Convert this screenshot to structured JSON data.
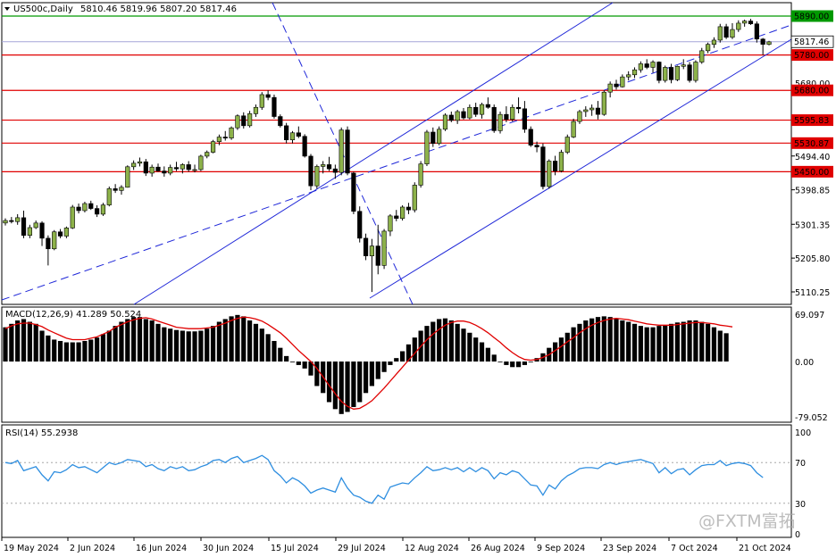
{
  "header": {
    "symbol": "US500c,Daily",
    "ohlc": "5810.46 5819.96 5807.20 5817.46"
  },
  "price_axis": {
    "ticks": [
      "5494.40",
      "5398.85",
      "5301.35",
      "5205.80",
      "5110.25"
    ],
    "current_price": "5817.46",
    "level_labels": [
      "5890.00",
      "5780.00",
      "5680.00",
      "5595.83",
      "5530.87",
      "5450.00"
    ],
    "faint_labels": [
      "5680.00"
    ]
  },
  "macd": {
    "label": "MACD(12,26,9) 41.289 50.524",
    "ticks": [
      "69.097",
      "0.00",
      "-79.052"
    ]
  },
  "rsi": {
    "label": "RSI(14) 55.2938",
    "ticks": [
      "100",
      "70",
      "30",
      "0"
    ]
  },
  "date_axis": {
    "labels": [
      "19 May 2024",
      "2 Jun 2024",
      "16 Jun 2024",
      "30 Jun 2024",
      "15 Jul 2024",
      "29 Jul 2024",
      "12 Aug 2024",
      "26 Aug 2024",
      "9 Sep 2024",
      "23 Sep 2024",
      "7 Oct 2024",
      "21 Oct 2024"
    ]
  },
  "watermark": "@FXTM富拓",
  "colors": {
    "bull": "#8db24a",
    "bear": "#000000",
    "level": "#e00000",
    "green_level": "#009900",
    "channel": "#1f27d8",
    "signal": "#e00000",
    "rsi": "#2e8ee0",
    "current_price_line": "#a6a6d9"
  },
  "chart_data": [
    {
      "type": "candlestick",
      "symbol": "US500c",
      "timeframe": "Daily",
      "y_range": [
        5070,
        5905
      ],
      "horizontal_levels": [
        5890.0,
        5780.0,
        5680.0,
        5595.83,
        5530.87,
        5450.0
      ],
      "current_price": 5817.46,
      "candles": [
        [
          5305,
          5318,
          5298,
          5312
        ],
        [
          5312,
          5322,
          5304,
          5309
        ],
        [
          5309,
          5330,
          5300,
          5320
        ],
        [
          5320,
          5340,
          5262,
          5270
        ],
        [
          5270,
          5300,
          5262,
          5292
        ],
        [
          5292,
          5312,
          5288,
          5305
        ],
        [
          5305,
          5310,
          5240,
          5262
        ],
        [
          5262,
          5270,
          5185,
          5232
        ],
        [
          5232,
          5285,
          5228,
          5280
        ],
        [
          5280,
          5288,
          5262,
          5268
        ],
        [
          5268,
          5295,
          5262,
          5291
        ],
        [
          5291,
          5356,
          5288,
          5350
        ],
        [
          5350,
          5360,
          5332,
          5340
        ],
        [
          5340,
          5365,
          5335,
          5360
        ],
        [
          5360,
          5368,
          5342,
          5346
        ],
        [
          5346,
          5355,
          5322,
          5330
        ],
        [
          5330,
          5362,
          5325,
          5356
        ],
        [
          5356,
          5408,
          5352,
          5402
        ],
        [
          5402,
          5415,
          5390,
          5397
        ],
        [
          5397,
          5412,
          5385,
          5406
        ],
        [
          5406,
          5468,
          5405,
          5464
        ],
        [
          5464,
          5482,
          5455,
          5474
        ],
        [
          5474,
          5490,
          5465,
          5478
        ],
        [
          5478,
          5486,
          5438,
          5446
        ],
        [
          5446,
          5470,
          5436,
          5463
        ],
        [
          5463,
          5473,
          5450,
          5452
        ],
        [
          5452,
          5465,
          5436,
          5446
        ],
        [
          5446,
          5470,
          5440,
          5462
        ],
        [
          5462,
          5478,
          5452,
          5458
        ],
        [
          5458,
          5474,
          5445,
          5470
        ],
        [
          5470,
          5480,
          5450,
          5456
        ],
        [
          5456,
          5470,
          5448,
          5456
        ],
        [
          5456,
          5498,
          5452,
          5494
        ],
        [
          5494,
          5510,
          5488,
          5505
        ],
        [
          5505,
          5540,
          5502,
          5535
        ],
        [
          5535,
          5555,
          5525,
          5548
        ],
        [
          5548,
          5565,
          5538,
          5545
        ],
        [
          5545,
          5578,
          5540,
          5574
        ],
        [
          5574,
          5612,
          5568,
          5608
        ],
        [
          5608,
          5618,
          5572,
          5580
        ],
        [
          5580,
          5622,
          5575,
          5614
        ],
        [
          5614,
          5640,
          5605,
          5632
        ],
        [
          5632,
          5675,
          5625,
          5668
        ],
        [
          5668,
          5680,
          5652,
          5660
        ],
        [
          5660,
          5668,
          5600,
          5606
        ],
        [
          5606,
          5612,
          5575,
          5580
        ],
        [
          5580,
          5588,
          5530,
          5540
        ],
        [
          5540,
          5565,
          5530,
          5560
        ],
        [
          5560,
          5578,
          5545,
          5550
        ],
        [
          5550,
          5556,
          5490,
          5494
        ],
        [
          5494,
          5500,
          5398,
          5410
        ],
        [
          5410,
          5470,
          5402,
          5465
        ],
        [
          5465,
          5480,
          5445,
          5470
        ],
        [
          5470,
          5492,
          5452,
          5458
        ],
        [
          5458,
          5470,
          5430,
          5448
        ],
        [
          5448,
          5575,
          5440,
          5568
        ],
        [
          5568,
          5578,
          5440,
          5446
        ],
        [
          5446,
          5450,
          5330,
          5338
        ],
        [
          5338,
          5352,
          5250,
          5262
        ],
        [
          5262,
          5275,
          5200,
          5212
        ],
        [
          5212,
          5260,
          5110,
          5240
        ],
        [
          5240,
          5300,
          5160,
          5185
        ],
        [
          5185,
          5288,
          5175,
          5282
        ],
        [
          5282,
          5330,
          5268,
          5325
        ],
        [
          5325,
          5342,
          5310,
          5318
        ],
        [
          5318,
          5355,
          5312,
          5350
        ],
        [
          5350,
          5362,
          5330,
          5342
        ],
        [
          5342,
          5420,
          5335,
          5412
        ],
        [
          5412,
          5480,
          5405,
          5472
        ],
        [
          5472,
          5568,
          5466,
          5562
        ],
        [
          5562,
          5575,
          5520,
          5530
        ],
        [
          5530,
          5578,
          5525,
          5570
        ],
        [
          5570,
          5615,
          5565,
          5610
        ],
        [
          5610,
          5620,
          5590,
          5595
        ],
        [
          5595,
          5625,
          5585,
          5620
        ],
        [
          5620,
          5630,
          5598,
          5602
        ],
        [
          5602,
          5640,
          5598,
          5632
        ],
        [
          5632,
          5645,
          5605,
          5612
        ],
        [
          5612,
          5645,
          5600,
          5640
        ],
        [
          5640,
          5660,
          5628,
          5632
        ],
        [
          5632,
          5640,
          5560,
          5566
        ],
        [
          5566,
          5620,
          5558,
          5612
        ],
        [
          5612,
          5635,
          5590,
          5598
        ],
        [
          5598,
          5640,
          5592,
          5632
        ],
        [
          5632,
          5660,
          5615,
          5628
        ],
        [
          5628,
          5650,
          5560,
          5570
        ],
        [
          5570,
          5578,
          5520,
          5525
        ],
        [
          5525,
          5535,
          5505,
          5520
        ],
        [
          5520,
          5530,
          5400,
          5408
        ],
        [
          5408,
          5485,
          5402,
          5480
        ],
        [
          5480,
          5495,
          5440,
          5452
        ],
        [
          5452,
          5512,
          5448,
          5505
        ],
        [
          5505,
          5555,
          5500,
          5548
        ],
        [
          5548,
          5600,
          5545,
          5592
        ],
        [
          5592,
          5625,
          5585,
          5620
        ],
        [
          5620,
          5635,
          5605,
          5625
        ],
        [
          5625,
          5640,
          5608,
          5630
        ],
        [
          5630,
          5650,
          5598,
          5612
        ],
        [
          5612,
          5680,
          5608,
          5675
        ],
        [
          5675,
          5705,
          5660,
          5698
        ],
        [
          5698,
          5710,
          5682,
          5690
        ],
        [
          5690,
          5725,
          5688,
          5718
        ],
        [
          5718,
          5734,
          5708,
          5724
        ],
        [
          5724,
          5745,
          5715,
          5738
        ],
        [
          5738,
          5762,
          5730,
          5755
        ],
        [
          5755,
          5768,
          5740,
          5745
        ],
        [
          5745,
          5765,
          5730,
          5760
        ],
        [
          5760,
          5762,
          5700,
          5708
        ],
        [
          5708,
          5750,
          5702,
          5745
        ],
        [
          5745,
          5755,
          5700,
          5710
        ],
        [
          5710,
          5750,
          5706,
          5748
        ],
        [
          5748,
          5768,
          5740,
          5752
        ],
        [
          5752,
          5760,
          5702,
          5708
        ],
        [
          5708,
          5765,
          5702,
          5760
        ],
        [
          5760,
          5800,
          5755,
          5792
        ],
        [
          5792,
          5815,
          5785,
          5810
        ],
        [
          5810,
          5830,
          5800,
          5822
        ],
        [
          5822,
          5868,
          5815,
          5860
        ],
        [
          5860,
          5868,
          5825,
          5830
        ],
        [
          5830,
          5870,
          5825,
          5852
        ],
        [
          5852,
          5878,
          5845,
          5870
        ],
        [
          5870,
          5880,
          5860,
          5876
        ],
        [
          5876,
          5882,
          5865,
          5868
        ],
        [
          5868,
          5875,
          5815,
          5825
        ],
        [
          5825,
          5828,
          5780,
          5810
        ],
        [
          5810,
          5820,
          5807,
          5817
        ]
      ]
    },
    {
      "type": "bar",
      "name": "MACD(12,26,9)",
      "y_range": [
        -79.052,
        69.097
      ],
      "histogram": [
        50,
        55,
        60,
        62,
        58,
        55,
        45,
        38,
        32,
        30,
        28,
        28,
        28,
        30,
        32,
        35,
        40,
        45,
        52,
        58,
        62,
        65,
        65,
        62,
        60,
        55,
        50,
        48,
        46,
        45,
        44,
        44,
        45,
        48,
        52,
        58,
        62,
        66,
        68,
        66,
        60,
        55,
        48,
        40,
        30,
        20,
        8,
        0,
        -5,
        -10,
        -20,
        -35,
        -45,
        -58,
        -68,
        -75,
        -72,
        -65,
        -58,
        -45,
        -35,
        -25,
        -15,
        -5,
        5,
        15,
        25,
        35,
        45,
        52,
        58,
        62,
        63,
        60,
        55,
        48,
        42,
        35,
        28,
        20,
        10,
        0,
        -5,
        -8,
        -8,
        -5,
        0,
        5,
        12,
        20,
        28,
        35,
        42,
        50,
        55,
        60,
        63,
        65,
        66,
        65,
        62,
        60,
        58,
        55,
        52,
        50,
        50,
        52,
        53,
        55,
        57,
        58,
        60,
        60,
        58,
        55,
        50,
        45,
        41.289
      ],
      "signal": [
        48,
        52,
        55,
        56,
        56,
        54,
        51,
        46,
        42,
        38,
        34,
        32,
        32,
        32,
        34,
        36,
        40,
        44,
        50,
        54,
        58,
        61,
        63,
        64,
        62,
        59,
        56,
        53,
        50,
        49,
        48,
        48,
        48,
        49,
        50,
        53,
        56,
        60,
        63,
        65,
        64,
        62,
        59,
        54,
        48,
        42,
        34,
        25,
        16,
        8,
        0,
        -10,
        -22,
        -34,
        -46,
        -57,
        -64,
        -68,
        -67,
        -62,
        -56,
        -47,
        -38,
        -28,
        -18,
        -8,
        2,
        12,
        22,
        32,
        40,
        47,
        53,
        57,
        59,
        59,
        57,
        53,
        48,
        42,
        35,
        28,
        20,
        13,
        7,
        3,
        2,
        3,
        6,
        10,
        16,
        22,
        29,
        35,
        42,
        48,
        53,
        57,
        60,
        62,
        63,
        62,
        61,
        59,
        57,
        55,
        54,
        53,
        53,
        53,
        54,
        55,
        56,
        57,
        57,
        56,
        55,
        53,
        52,
        50.524
      ]
    },
    {
      "type": "line",
      "name": "RSI(14)",
      "y_range": [
        0,
        100
      ],
      "reference_lines": [
        70,
        30
      ],
      "values": [
        70,
        69,
        72,
        62,
        64,
        66,
        58,
        52,
        61,
        60,
        63,
        68,
        65,
        66,
        63,
        60,
        65,
        70,
        68,
        70,
        73,
        72,
        71,
        66,
        68,
        64,
        62,
        66,
        64,
        66,
        62,
        63,
        66,
        68,
        72,
        73,
        70,
        74,
        76,
        70,
        72,
        74,
        77,
        73,
        62,
        57,
        50,
        55,
        52,
        47,
        40,
        43,
        45,
        43,
        41,
        55,
        45,
        38,
        36,
        32,
        30,
        38,
        34,
        46,
        48,
        50,
        49,
        55,
        60,
        66,
        62,
        63,
        65,
        63,
        65,
        61,
        65,
        61,
        65,
        62,
        54,
        60,
        58,
        62,
        60,
        54,
        48,
        47,
        38,
        48,
        44,
        52,
        57,
        60,
        64,
        65,
        65,
        64,
        68,
        70,
        68,
        70,
        71,
        72,
        73,
        71,
        69,
        60,
        65,
        59,
        63,
        64,
        58,
        63,
        67,
        68,
        68,
        72,
        67,
        69,
        70,
        69,
        67,
        60,
        55.2938
      ]
    }
  ]
}
